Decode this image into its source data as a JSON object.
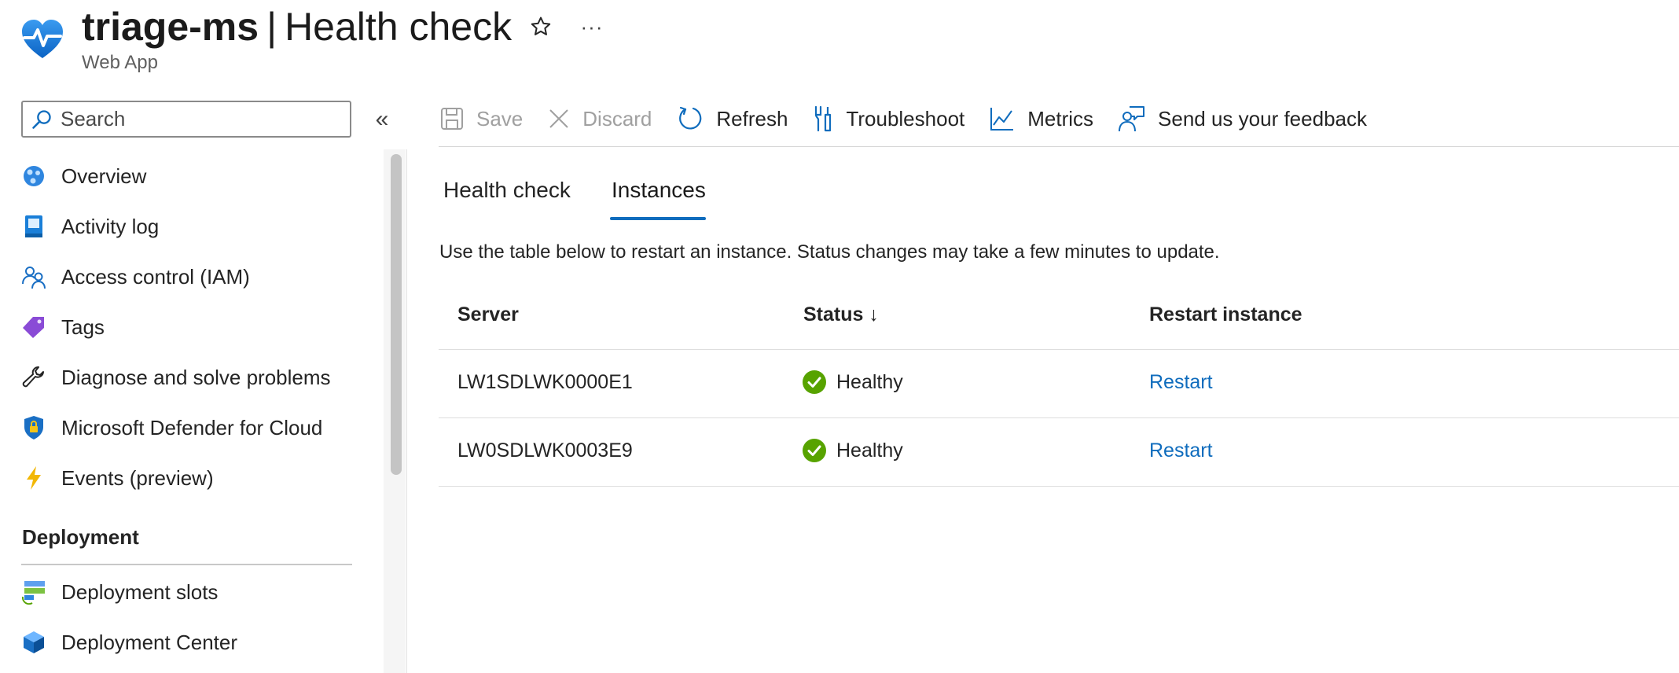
{
  "header": {
    "resource_name": "triage-ms",
    "separator": "|",
    "page_title": "Health check",
    "subtitle": "Web App",
    "more_label": "···",
    "app_icon": "heart-pulse-icon"
  },
  "sidebar": {
    "search_placeholder": "Search",
    "collapse_label": "«",
    "items": [
      {
        "label": "Overview",
        "icon": "globe-icon"
      },
      {
        "label": "Activity log",
        "icon": "log-book-icon"
      },
      {
        "label": "Access control (IAM)",
        "icon": "people-icon"
      },
      {
        "label": "Tags",
        "icon": "tag-icon"
      },
      {
        "label": "Diagnose and solve problems",
        "icon": "wrench-icon"
      },
      {
        "label": "Microsoft Defender for Cloud",
        "icon": "shield-lock-icon"
      },
      {
        "label": "Events (preview)",
        "icon": "lightning-icon"
      }
    ],
    "section_title": "Deployment",
    "section_items": [
      {
        "label": "Deployment slots",
        "icon": "slots-icon"
      },
      {
        "label": "Deployment Center",
        "icon": "cube-icon"
      }
    ]
  },
  "toolbar": {
    "save": "Save",
    "discard": "Discard",
    "refresh": "Refresh",
    "troubleshoot": "Troubleshoot",
    "metrics": "Metrics",
    "feedback": "Send us your feedback"
  },
  "tabs": {
    "health_check": "Health check",
    "instances": "Instances",
    "active": "Instances"
  },
  "description": "Use the table below to restart an instance. Status changes may take a few minutes to update.",
  "table": {
    "headers": {
      "server": "Server",
      "status": "Status ↓",
      "restart": "Restart instance"
    },
    "rows": [
      {
        "server": "LW1SDLWK0000E1",
        "status": "Healthy",
        "action": "Restart"
      },
      {
        "server": "LW0SDLWK0003E9",
        "status": "Healthy",
        "action": "Restart"
      }
    ]
  },
  "colors": {
    "accent": "#0f6cbd",
    "healthy": "#57a300"
  }
}
